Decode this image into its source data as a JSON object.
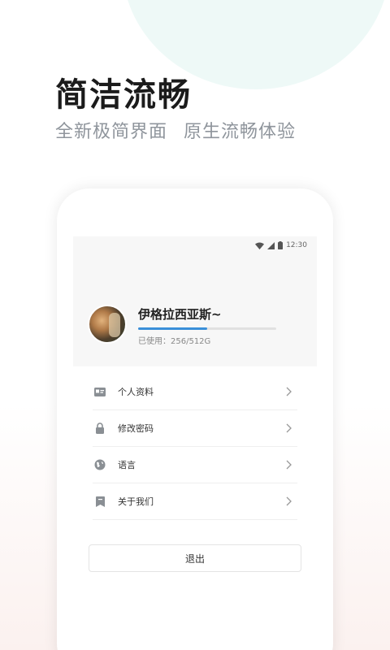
{
  "promo": {
    "headline": "简洁流畅",
    "subline_left": "全新极简界面",
    "subline_right": "原生流畅体验"
  },
  "status_bar": {
    "time": "12:30"
  },
  "profile": {
    "username": "伊格拉西亚斯~",
    "usage_text": "已使用：256/512G",
    "usage_progress_fraction": 0.5
  },
  "menu": {
    "items": [
      {
        "label": "个人资料",
        "icon": "id-card-icon"
      },
      {
        "label": "修改密码",
        "icon": "lock-icon"
      },
      {
        "label": "语言",
        "icon": "globe-icon"
      },
      {
        "label": "关于我们",
        "icon": "bookmark-icon"
      }
    ]
  },
  "actions": {
    "logout_label": "退出"
  },
  "colors": {
    "accent": "#3a8fd9",
    "bg_circle": "#eef9f7"
  }
}
